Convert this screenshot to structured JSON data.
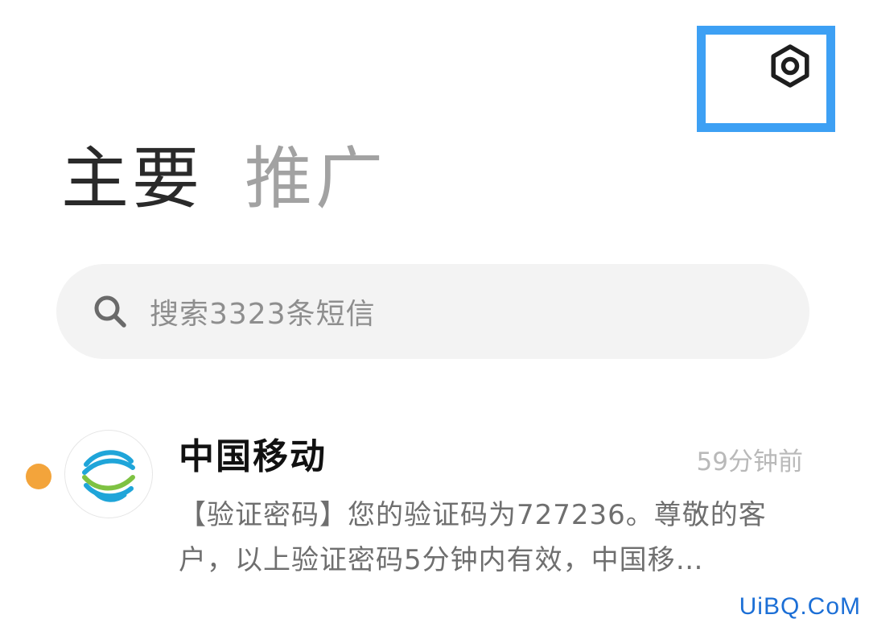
{
  "header": {
    "settings_icon": "settings-gear-icon",
    "highlight_color": "#3da0f4"
  },
  "tabs": [
    {
      "label": "主要",
      "active": true
    },
    {
      "label": "推广",
      "active": false
    }
  ],
  "search": {
    "icon": "search-icon",
    "placeholder": "搜索3323条短信"
  },
  "messages": [
    {
      "sender": "中国移动",
      "time": "59分钟前",
      "preview": "【验证密码】您的验证码为727236。尊敬的客户，以上验证密码5分钟内有效，中国移…",
      "unread": true,
      "unread_color": "#f3a43b",
      "avatar_icon": "china-mobile-logo"
    }
  ],
  "watermark": "UiBQ.CoM"
}
